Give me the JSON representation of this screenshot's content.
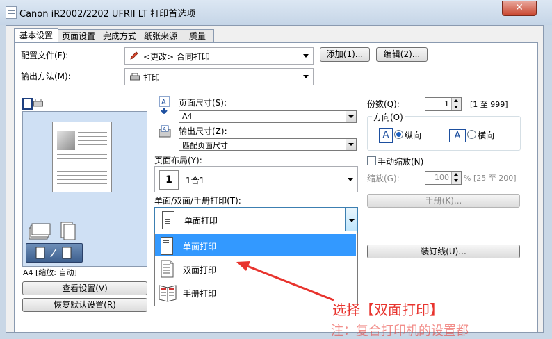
{
  "window": {
    "title": "Canon iR2002/2202 UFRII LT 打印首选项",
    "close_label": "✕"
  },
  "tabs": [
    {
      "label": "基本设置",
      "active": true
    },
    {
      "label": "页面设置",
      "active": false
    },
    {
      "label": "完成方式",
      "active": false
    },
    {
      "label": "纸张来源",
      "active": false
    },
    {
      "label": "质量",
      "active": false
    }
  ],
  "profile": {
    "label": "配置文件(F):",
    "value": "<更改> 合同打印",
    "add_button": "添加(1)...",
    "edit_button": "编辑(2)..."
  },
  "output_method": {
    "label": "输出方法(M):",
    "value": "打印"
  },
  "page_size": {
    "label": "页面尺寸(S):",
    "value": "A4"
  },
  "output_size": {
    "label": "输出尺寸(Z):",
    "value": "匹配页面尺寸"
  },
  "page_layout": {
    "label": "页面布局(Y):",
    "value": "1合1",
    "icon_number": "1"
  },
  "duplex": {
    "label": "单面/双面/手册打印(T):",
    "value": "单面打印",
    "options": [
      "单面打印",
      "双面打印",
      "手册打印"
    ],
    "highlighted_index": 0
  },
  "copies": {
    "label": "份数(Q):",
    "value": "1",
    "range": "[1 至 999]"
  },
  "orientation": {
    "label": "方向(O)",
    "portrait": "纵向",
    "landscape": "横向",
    "selected": "portrait"
  },
  "manual_scaling": {
    "label": "手动缩放(N)",
    "checked": false
  },
  "scaling": {
    "label": "缩放(G):",
    "value": "100",
    "range": "% [25 至 200]"
  },
  "booklet_button": "手册(K)...",
  "binding_button": "装订线(U)...",
  "preview": {
    "status": "A4 [缩放: 自动]",
    "view_settings_button": "查看设置(V)",
    "restore_defaults_button": "恢复默认设置(R)"
  },
  "annotation": {
    "text": "选择【双面打印】",
    "bottom_partial": "注：复合打印机的设置都"
  },
  "colors": {
    "accent": "#3399ff",
    "annotation": "#e8342e"
  }
}
